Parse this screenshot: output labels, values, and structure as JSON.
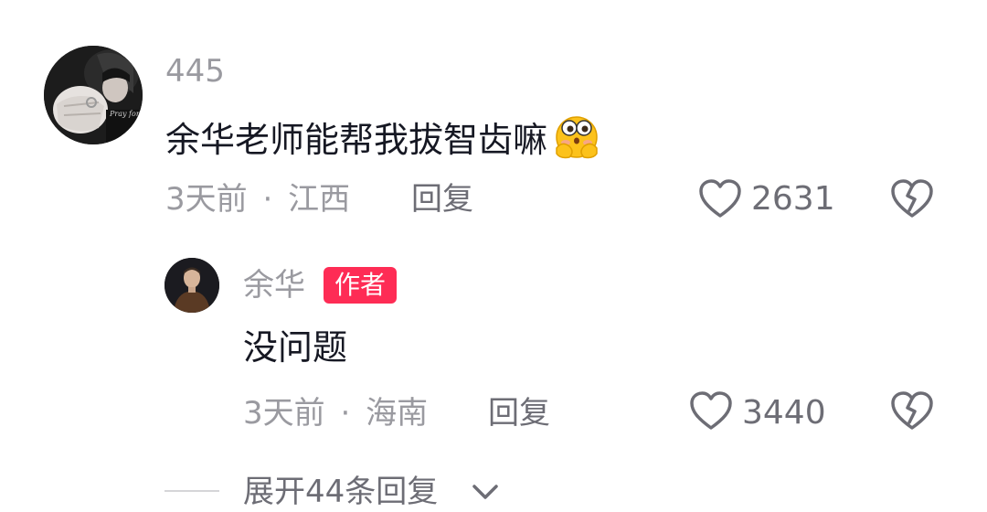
{
  "comment": {
    "username": "445",
    "text": "余华老师能帮我拔智齿嘛",
    "emoji": "thinking-face-emoji",
    "time": "3天前",
    "separator": "·",
    "location": "江西",
    "reply_label": "回复",
    "likes": "2631",
    "avatar_caption": "Pray for me"
  },
  "reply": {
    "username": "余华",
    "badge": "作者",
    "text": "没问题",
    "time": "3天前",
    "separator": "·",
    "location": "海南",
    "reply_label": "回复",
    "likes": "3440"
  },
  "expand": {
    "label": "展开44条回复"
  },
  "colors": {
    "primary_text": "#161823",
    "secondary_text": "#9a9aa0",
    "badge_bg": "#fe2c55"
  },
  "icons": [
    "heart-outline-icon",
    "broken-heart-icon",
    "chevron-down-icon"
  ]
}
